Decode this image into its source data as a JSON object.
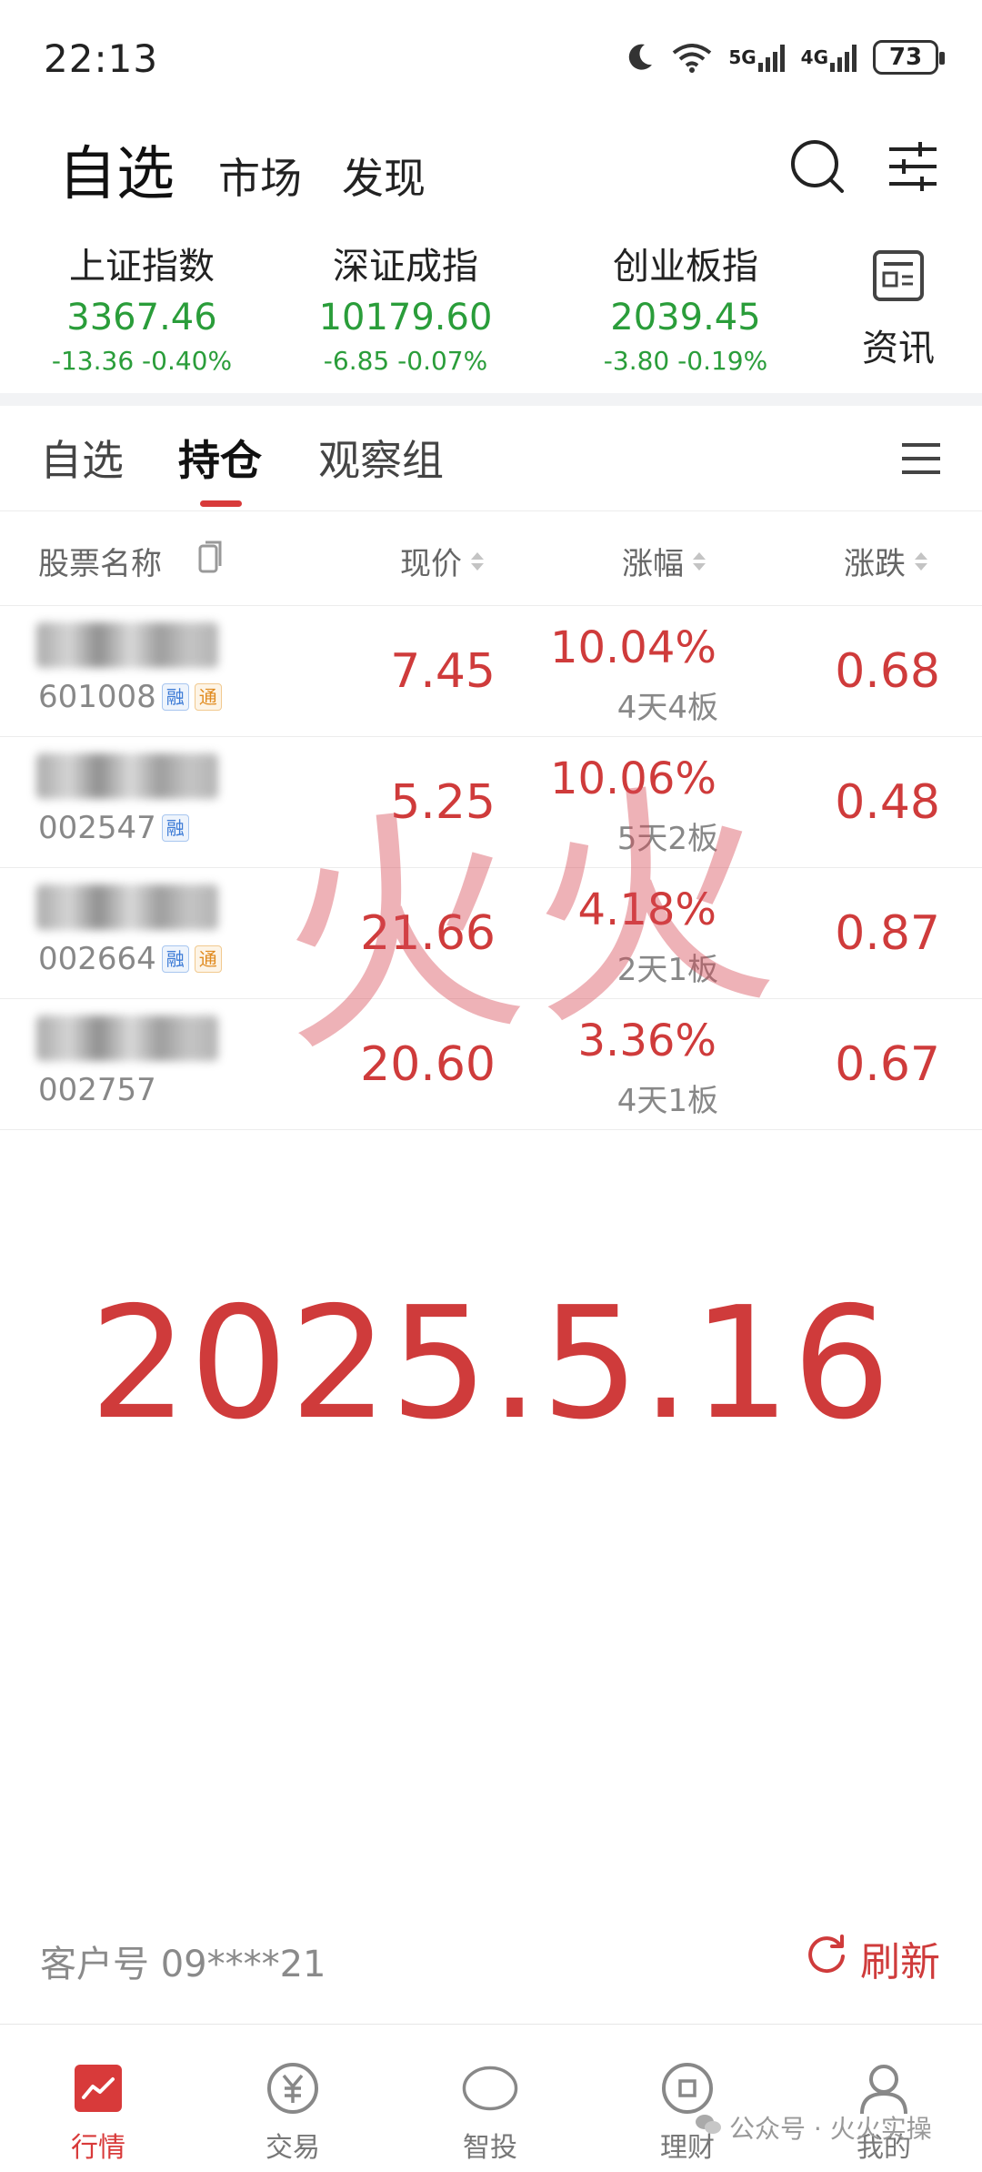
{
  "status_bar": {
    "time": "22:13",
    "net1": "5G",
    "net2": "4G",
    "battery": "73"
  },
  "top_nav": {
    "tabs": [
      "自选",
      "市场",
      "发现"
    ],
    "active_tab": "自选",
    "icons": [
      "search-icon",
      "filter-settings-icon"
    ]
  },
  "indices": [
    {
      "name": "上证指数",
      "value": "3367.46",
      "change": "-13.36  -0.40%"
    },
    {
      "name": "深证成指",
      "value": "10179.60",
      "change": "-6.85  -0.07%"
    },
    {
      "name": "创业板指",
      "value": "2039.45",
      "change": "-3.80  -0.19%"
    }
  ],
  "news": {
    "label": "资讯",
    "icon": "news-icon"
  },
  "sub_tabs": {
    "items": [
      "自选",
      "持仓",
      "观察组"
    ],
    "active": "持仓"
  },
  "table": {
    "headers": {
      "name": "股票名称",
      "price": "现价",
      "pct": "涨幅",
      "change": "涨跌"
    },
    "rows": [
      {
        "code": "601008",
        "badges": [
          "融",
          "通"
        ],
        "price": "7.45",
        "pct": "10.04%",
        "board": "4天4板",
        "change": "0.68"
      },
      {
        "code": "002547",
        "badges": [
          "融"
        ],
        "price": "5.25",
        "pct": "10.06%",
        "board": "5天2板",
        "change": "0.48"
      },
      {
        "code": "002664",
        "badges": [
          "融",
          "通"
        ],
        "price": "21.66",
        "pct": "4.18%",
        "board": "2天1板",
        "change": "0.87"
      },
      {
        "code": "002757",
        "badges": [],
        "price": "20.60",
        "pct": "3.36%",
        "board": "4天1板",
        "change": "0.67"
      }
    ]
  },
  "watermark": {
    "text": "火火",
    "date": "2025.5.16"
  },
  "footer": {
    "client_no": "客户号 09****21",
    "refresh_label": "刷新"
  },
  "bottom_nav": [
    {
      "label": "行情",
      "icon": "market-chart-icon",
      "active": true
    },
    {
      "label": "交易",
      "icon": "trade-yuan-icon",
      "active": false
    },
    {
      "label": "智投",
      "icon": "smart-invest-icon",
      "active": false
    },
    {
      "label": "理财",
      "icon": "wealth-icon",
      "active": false
    },
    {
      "label": "我的",
      "icon": "profile-icon",
      "active": false
    }
  ],
  "wechat_tag": "公众号 · 火火实操",
  "colors": {
    "up_red": "#cf3b3b",
    "down_green": "#2a9d3a",
    "accent": "#d83a3a"
  }
}
